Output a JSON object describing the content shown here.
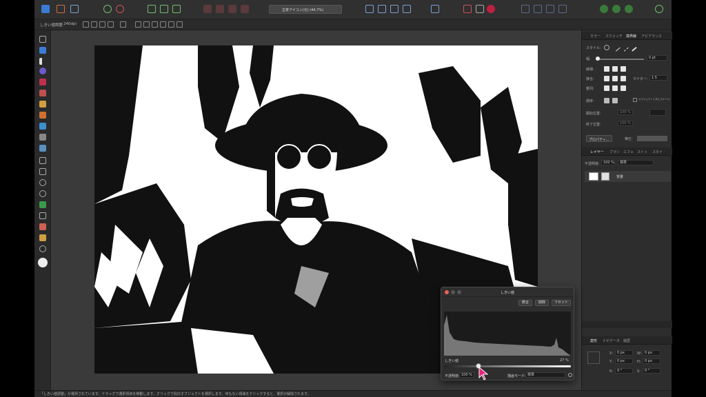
{
  "toolbar": {
    "persona_label": "",
    "font_dropdown": "古茶アイコン(元) (44.7%)"
  },
  "context_bar": {
    "tool_name": "しきい値調整",
    "dpi": "240dpi"
  },
  "panel": {
    "top_tabs": [
      "カラー",
      "スウォッチ",
      "境界線",
      "アピアランス"
    ],
    "style_label": "スタイル:",
    "width_label": "幅:",
    "width_value": "0 pt",
    "cap_label": "線端:",
    "join_label": "接合:",
    "miter_label": "マイター:",
    "miter_value": "1.5",
    "align_label": "整列:",
    "order_label": "順序:",
    "scale_label": "オブジェクトと共にスケール",
    "start_label": "開始位置:",
    "start_value": "100 %",
    "end_label": "終了位置:",
    "end_value": "100 %",
    "properties_button": "プロパティ...",
    "pressure_label": "筆圧:",
    "layer_tabs": [
      "レイヤー",
      "ブラシ",
      "エフェ",
      "ストッ",
      "スタイ"
    ],
    "opacity_label": "不透明度:",
    "opacity_value": "100 %",
    "blend_value": "標準",
    "layer_name": "背景",
    "transform_tabs": [
      "変形",
      "ナビゲータ",
      "履歴"
    ],
    "x_label": "X:",
    "x_value": "0 px",
    "y_label": "Y:",
    "y_value": "0 px",
    "w_label": "W:",
    "w_value": "0 px",
    "h_label": "H:",
    "h_value": "0 px",
    "r_label": "R:",
    "r_value": "0 °",
    "s_label": "S:",
    "s_value": "0 °"
  },
  "dialog": {
    "title": "しきい値",
    "merge_button": "統合",
    "delete_button": "削除",
    "reset_button": "リセット",
    "threshold_label": "しきい値",
    "threshold_value": "27 %",
    "threshold_fraction": 0.27,
    "opacity_label": "不透明度:",
    "opacity_value": "100 %",
    "blend_label": "描画モード:",
    "blend_value": "標準"
  },
  "statusbar": {
    "text": "「しきい値調整」が選択されています。ドラッグで選択項目を移動します。クリックで別のオブジェクトを選択します。何もない領域をクリックすると、選択が解除されます。"
  },
  "colors": {
    "accent": "#3b7bd4",
    "close": "#ec5f57",
    "minimize": "#f5bf4f",
    "zoom": "#61c454",
    "cursor": "#e8207a"
  }
}
